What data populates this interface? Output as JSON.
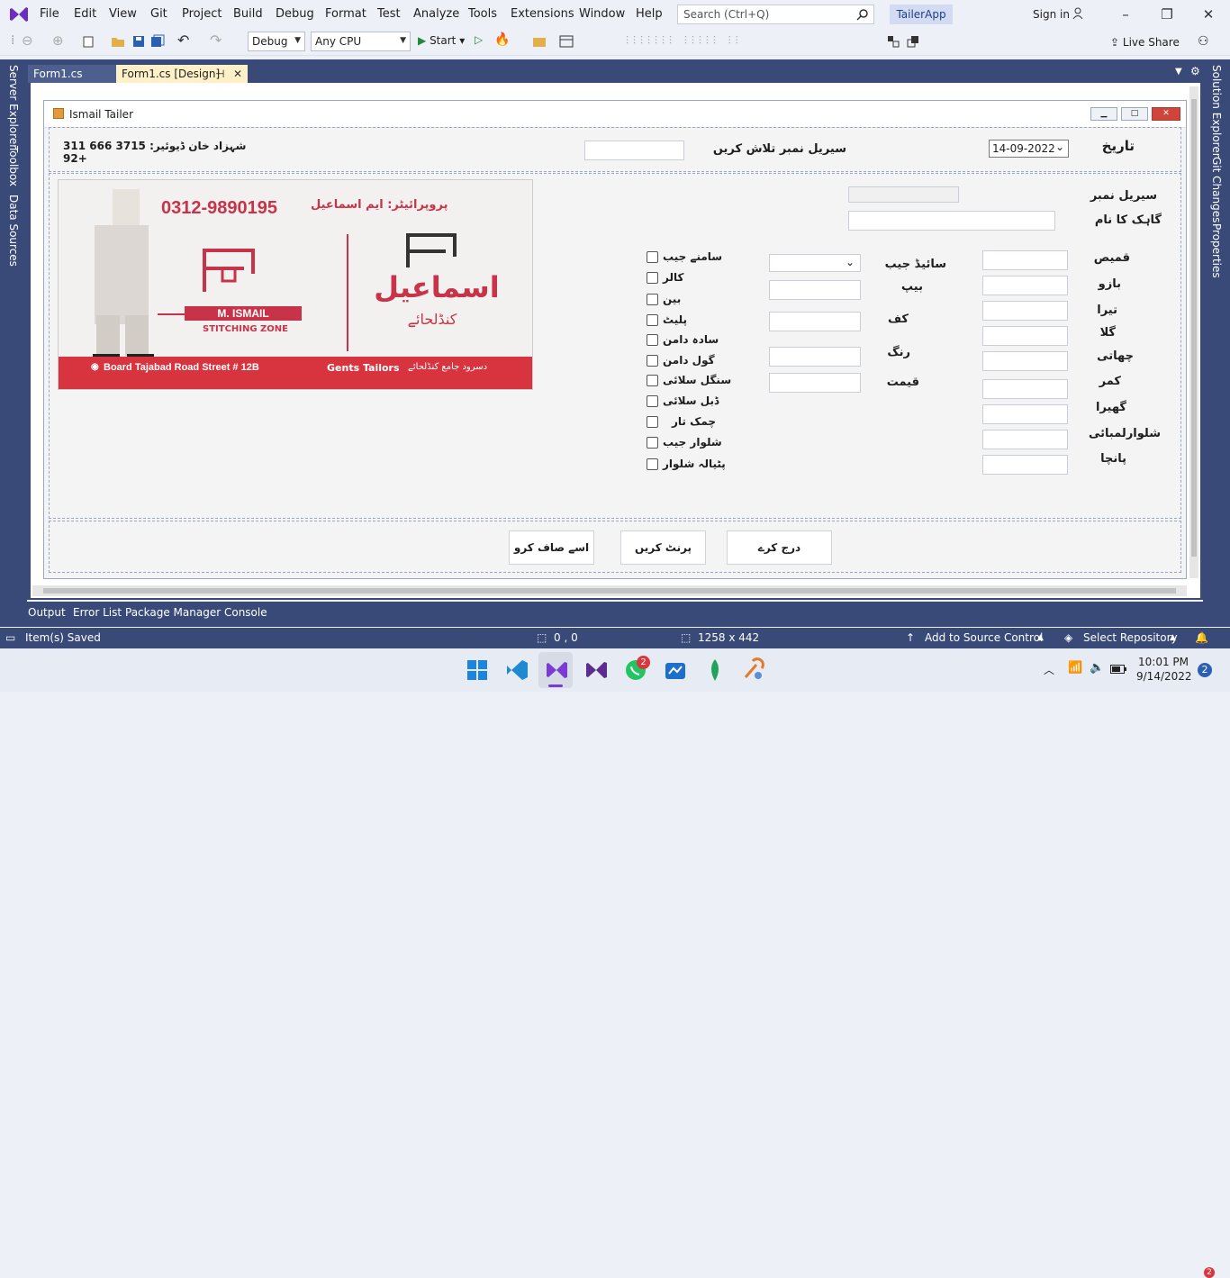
{
  "menu": [
    "File",
    "Edit",
    "View",
    "Git",
    "Project",
    "Build",
    "Debug",
    "Format",
    "Test",
    "Analyze",
    "Tools",
    "Extensions",
    "Window",
    "Help"
  ],
  "search": {
    "placeholder": "Search (Ctrl+Q)"
  },
  "app_title": "TailerApp",
  "signin": "Sign in",
  "toolbar": {
    "config": "Debug",
    "platform": "Any CPU",
    "start": "Start",
    "live_share": "Live Share"
  },
  "tabs": [
    {
      "label": "Form1.cs"
    },
    {
      "label": "Form1.cs [Design]"
    }
  ],
  "left_tools": [
    "Server Explorer",
    "Toolbox",
    "Data Sources"
  ],
  "right_tools": [
    "Solution Explorer",
    "Git Changes",
    "Properties"
  ],
  "form": {
    "title": "Ismail Tailer",
    "owner": "شہزاد خان ڈیوئیر: 3715 666 311 92+",
    "search_label": "سیریل نمبر تلاش کریں",
    "date_label": "تاریخ",
    "date_value": "14-09-2022",
    "serial_label": "سیریل نمبر",
    "customer_label": "گاہک کا نام",
    "measurements": [
      "قمیص",
      "بازو",
      "تیرا",
      "گلا",
      "چھاتی",
      "کمر",
      "گھیرا",
      "شلوارلمبائی",
      "پانچا"
    ],
    "mid_labels": [
      "سائیڈ جیب",
      "بیپ",
      "کف",
      "رنگ",
      "قیمت"
    ],
    "checks": [
      "سامنے جیب",
      "کالر",
      "بین",
      "پلیٹ",
      "سادہ دامن",
      "گول دامن",
      "سنگل سلائی",
      "ڈبل سلائی",
      "چمک تار",
      "شلوار جیب",
      "پٹیالہ شلوار"
    ],
    "buttons": {
      "clear": "اسے صاف کرو",
      "print": "پرنٹ کریں",
      "save": "درج کرے"
    },
    "banner": {
      "phone": "0312-9890195",
      "prop": "پروپرائیٹر: ایم اسماعیل",
      "name": "M. ISMAIL",
      "zone": "STITCHING ZONE",
      "urdu_name": "اسماعیل",
      "urdu_sub": "کنڈلحائے",
      "address": "Board Tajabad Road Street # 12B",
      "gents": "Gents Tailors",
      "footer_urdu": "دسرود جامع کنڈلحائے"
    }
  },
  "bottom_tabs": [
    "Output",
    "Error List",
    "Package Manager Console"
  ],
  "status": {
    "saved": "Item(s) Saved",
    "pos": "0 , 0",
    "size": "1258 x 442",
    "source": "Add to Source Control",
    "repo": "Select Repository",
    "notif": "2"
  },
  "clock": {
    "time": "10:01 PM",
    "date": "9/14/2022"
  },
  "taskbar_badges": {
    "whatsapp": "2",
    "notifications": "2"
  }
}
